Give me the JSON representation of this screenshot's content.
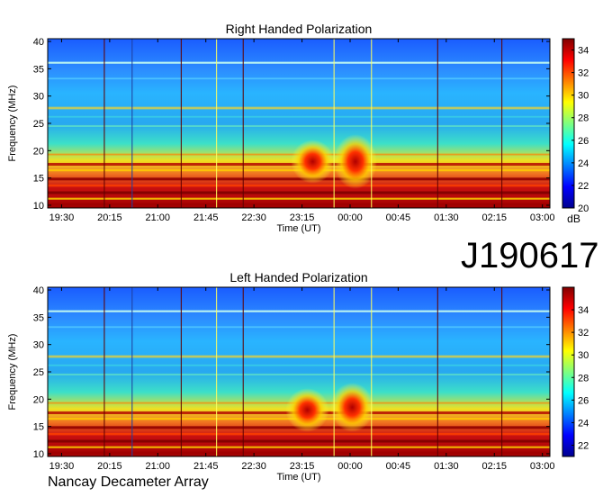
{
  "header_label": "J190617",
  "footer_label": "Nancay Decameter Array",
  "chart_data": [
    {
      "type": "heatmap",
      "title": "Right Handed Polarization",
      "xlabel": "Time (UT)",
      "ylabel": "Frequency (MHz)",
      "x_ticks": [
        "19:30",
        "20:15",
        "21:00",
        "21:45",
        "22:30",
        "23:15",
        "00:00",
        "00:45",
        "01:30",
        "02:15",
        "03:00"
      ],
      "xlim": [
        "19:17",
        "03:07"
      ],
      "y_ticks": [
        10,
        15,
        20,
        25,
        30,
        35,
        40
      ],
      "ylim": [
        9.5,
        40.5
      ],
      "colorbar": {
        "label": "dB",
        "ticks": [
          20,
          22,
          24,
          26,
          28,
          30,
          32,
          34
        ],
        "range": [
          20,
          35
        ]
      },
      "bursts": [
        {
          "time": "23:25",
          "freq_low": 14,
          "freq_high": 22
        },
        {
          "time": "00:05",
          "freq_low": 13,
          "freq_high": 23
        }
      ]
    },
    {
      "type": "heatmap",
      "title": "Left Handed Polarization",
      "xlabel": "Time (UT)",
      "ylabel": "Frequency (MHz)",
      "x_ticks": [
        "19:30",
        "20:15",
        "21:00",
        "21:45",
        "22:30",
        "23:15",
        "00:00",
        "00:45",
        "01:30",
        "02:15",
        "03:00"
      ],
      "xlim": [
        "19:17",
        "03:07"
      ],
      "y_ticks": [
        10,
        15,
        20,
        25,
        30,
        35,
        40
      ],
      "ylim": [
        9.5,
        40.5
      ],
      "colorbar": {
        "label": "",
        "ticks": [
          22,
          24,
          26,
          28,
          30,
          32,
          34
        ],
        "range": [
          21,
          36
        ]
      },
      "bursts": [
        {
          "time": "23:20",
          "freq_low": 14,
          "freq_high": 22
        },
        {
          "time": "00:02",
          "freq_low": 14,
          "freq_high": 23
        }
      ]
    }
  ]
}
